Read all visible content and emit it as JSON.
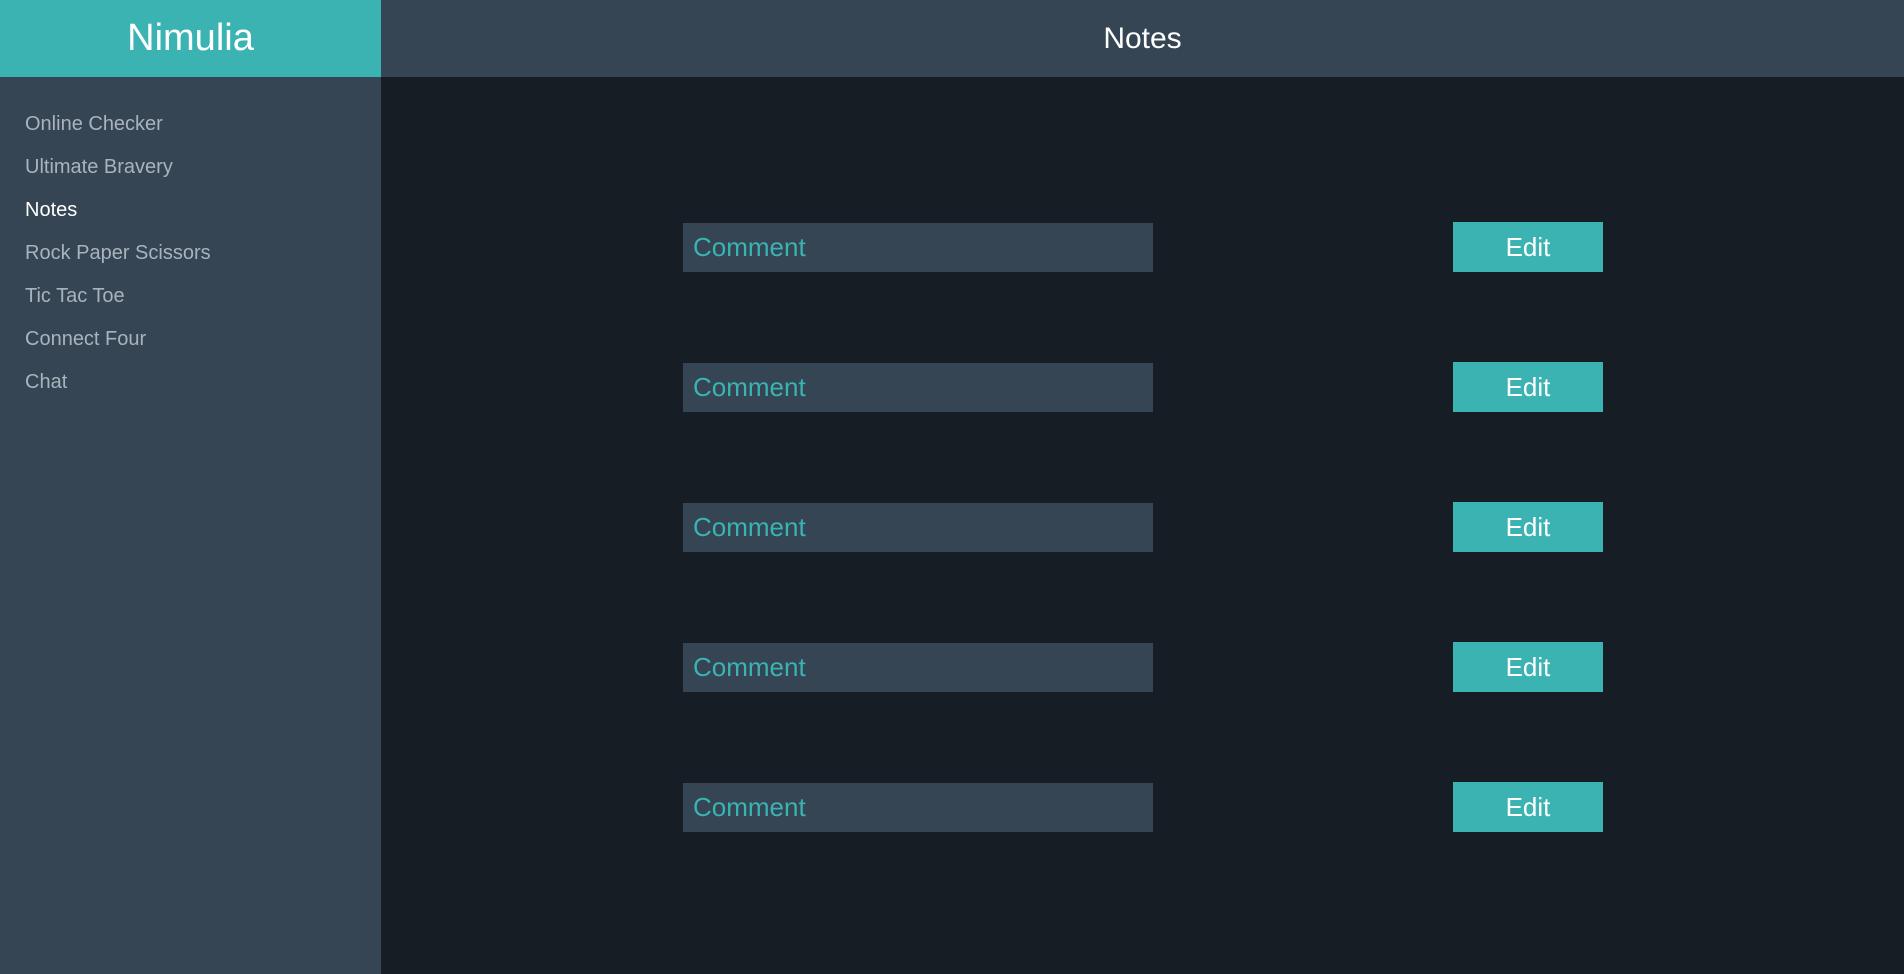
{
  "app": {
    "brand": "Nimulia"
  },
  "header": {
    "title": "Notes"
  },
  "sidebar": {
    "items": [
      {
        "label": "Online Checker"
      },
      {
        "label": "Ultimate Bravery"
      },
      {
        "label": "Notes"
      },
      {
        "label": "Rock Paper Scissors"
      },
      {
        "label": "Tic Tac Toe"
      },
      {
        "label": "Connect Four"
      },
      {
        "label": "Chat"
      }
    ],
    "active": "Notes"
  },
  "notes": [
    {
      "placeholder": "Comment",
      "value": "",
      "edit_label": "Edit"
    },
    {
      "placeholder": "Comment",
      "value": "",
      "edit_label": "Edit"
    },
    {
      "placeholder": "Comment",
      "value": "",
      "edit_label": "Edit"
    },
    {
      "placeholder": "Comment",
      "value": "",
      "edit_label": "Edit"
    },
    {
      "placeholder": "Comment",
      "value": "",
      "edit_label": "Edit"
    }
  ],
  "colors": {
    "accent": "#3bb3b2",
    "panel": "#354554",
    "background": "#161d25",
    "nav_text": "#a9b3bd",
    "active_text": "#ffffff"
  }
}
